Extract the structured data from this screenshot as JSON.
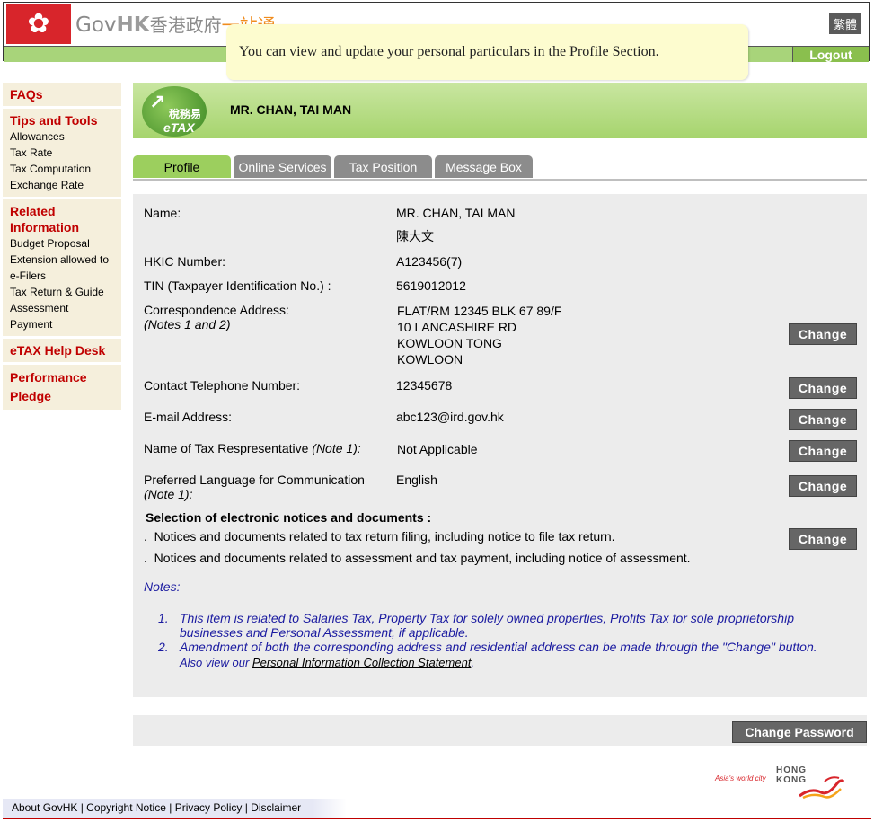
{
  "header": {
    "logo_gov": "Gov",
    "logo_hk": "HK",
    "logo_cn": "香港政府",
    "logo_one": "一站通",
    "lang_button": "繁體",
    "logout": "Logout",
    "flag_icon": "bauhinia-flag-icon"
  },
  "tooltip": {
    "text": "You can view and update your personal particulars in the Profile Section."
  },
  "sidebar": {
    "faqs": "FAQs",
    "tips_title": "Tips and Tools",
    "tips_items": [
      "Allowances",
      "Tax Rate",
      "Tax Computation",
      "Exchange Rate"
    ],
    "related_title": "Related Information",
    "related_items": [
      "Budget Proposal",
      "Extension allowed to e-Filers",
      "Tax Return & Guide",
      "Assessment",
      "Payment"
    ],
    "help_desk": "eTAX Help Desk",
    "pledge": "Performance Pledge"
  },
  "banner": {
    "logo_cn": "稅務易",
    "logo_en": "eTAX",
    "user_name": "MR. CHAN, TAI MAN"
  },
  "tabs": [
    {
      "label": "Profile",
      "active": true
    },
    {
      "label": "Online Services",
      "active": false
    },
    {
      "label": "Tax Position",
      "active": false
    },
    {
      "label": "Message Box",
      "active": false
    }
  ],
  "profile": {
    "name_label": "Name:",
    "name_value": "MR. CHAN, TAI MAN",
    "name_cn": "陳大文",
    "hkic_label": "HKIC Number:",
    "hkic_value": "A123456(7)",
    "tin_label": "TIN (Taxpayer Identification No.) :",
    "tin_value": "5619012012",
    "addr_label": "Correspondence Address:",
    "addr_note": "(Notes 1 and 2)",
    "addr_lines": [
      "FLAT/RM 12345 BLK 67 89/F",
      "10 LANCASHIRE RD",
      "KOWLOON TONG",
      "KOWLOON"
    ],
    "tel_label": "Contact Telephone Number:",
    "tel_value": "12345678",
    "email_label": "E-mail Address:",
    "email_value": "abc123@ird.gov.hk",
    "rep_label": "Name of Tax Respresentative",
    "rep_note": "(Note 1):",
    "rep_value": "Not Applicable",
    "lang_label": "Preferred Language for Communication",
    "lang_note": "(Note 1):",
    "lang_value": "English",
    "selection_heading": "Selection of electronic notices and documents :",
    "selection_items": [
      "Notices and documents related to tax return filing, including notice to file tax return.",
      "Notices and documents related to assessment and tax payment, including notice of assessment."
    ],
    "bullet": ".",
    "change_label": "Change"
  },
  "notes": {
    "title": "Notes:",
    "items": [
      {
        "num": "1.",
        "line1": "This item is related to Salaries Tax, Property Tax for solely owned properties, Profits Tax for sole proprietorship",
        "line2": "businesses and Personal Assessment, if applicable."
      },
      {
        "num": "2.",
        "line1": "Amendment of both the corresponding address and residential address can be made through the \"Change\" button.",
        "line2_prefix": "Also view our ",
        "line2_link": "Personal Information Collection Statement",
        "line2_suffix": "."
      }
    ]
  },
  "change_password": "Change Password",
  "hk_brand": {
    "tagline": "Asia's world city",
    "line1": "HONG",
    "line2": "KONG"
  },
  "footer": {
    "links": [
      "About GovHK",
      "Copyright Notice",
      "Privacy Policy",
      "Disclaimer"
    ],
    "separator": " | "
  }
}
